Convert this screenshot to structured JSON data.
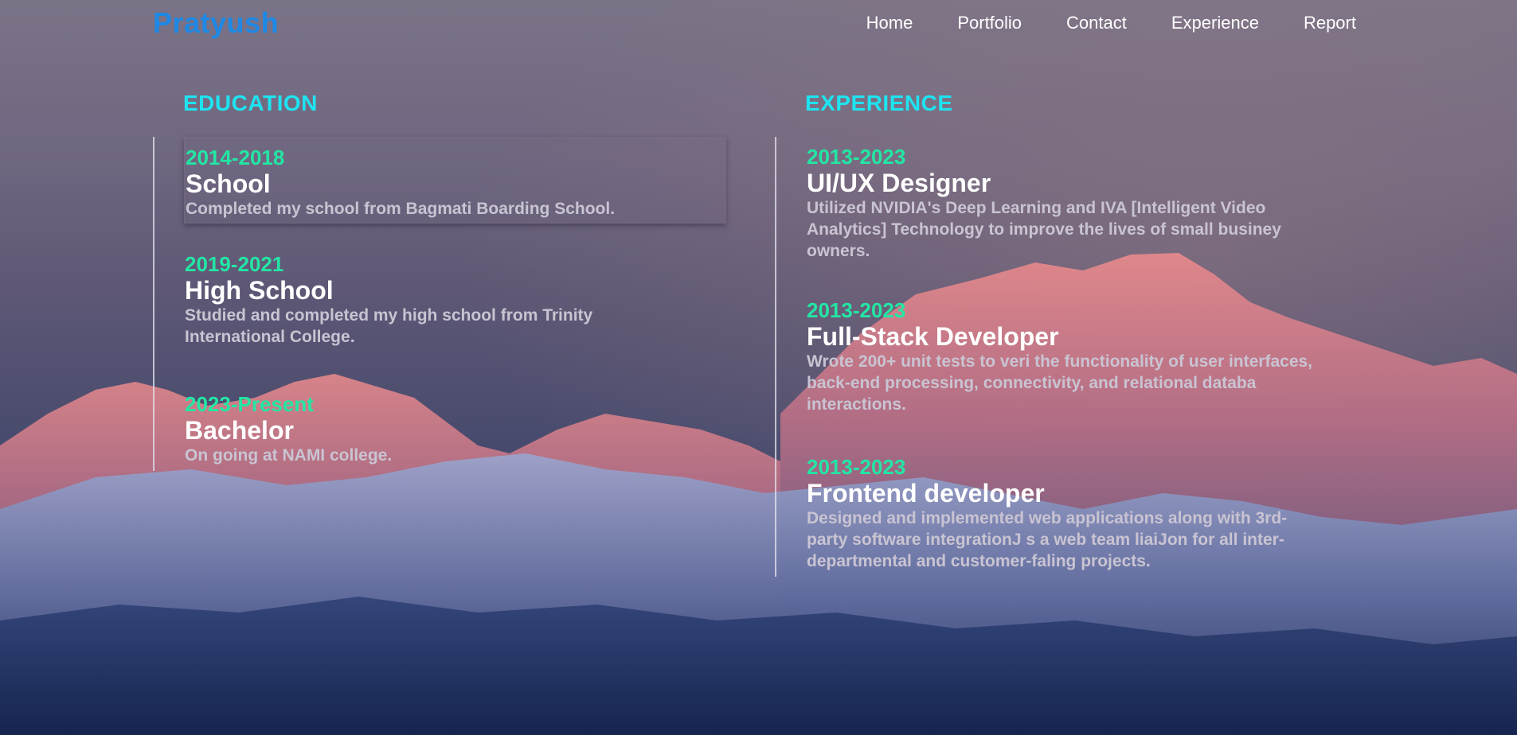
{
  "header": {
    "brand": "Pratyush",
    "nav": [
      "Home",
      "Portfolio",
      "Contact",
      "Experience",
      "Report"
    ]
  },
  "education": {
    "title": "EDUCATION",
    "items": [
      {
        "years": "2014-2018",
        "role": "School",
        "desc": "Completed my school from Bagmati Boarding School."
      },
      {
        "years": "2019-2021",
        "role": "High School",
        "desc": "Studied and completed my high school from Trinity International College."
      },
      {
        "years": "2023-Present",
        "role": "Bachelor",
        "desc": "On going at NAMI college."
      }
    ]
  },
  "experience": {
    "title": "EXPERIENCE",
    "items": [
      {
        "years": "2013-2023",
        "role": "UI/UX Designer",
        "desc": "Utilized NVIDIA's Deep Learning and IVA [Intelligent Video Analytics] Technology to improve the lives of small businey owners."
      },
      {
        "years": "2013-2023",
        "role": "Full-Stack Developer",
        "desc": "Wrote 200+ unit tests to veri the functionality of user interfaces, back-end processing, connectivity, and relational databa interactions."
      },
      {
        "years": "2013-2023",
        "role": "Frontend developer",
        "desc": "Designed and implemented web applications along with 3rd-party software integrationJ s a web team liaiJon for all inter-departmental and customer-faling projects."
      }
    ]
  },
  "theme": {
    "brand_color": "#1e88e5",
    "section_title_color": "#1ee3f0",
    "years_color": "#23e6a4",
    "role_color": "#ffffff",
    "desc_color": "#c9c4d2"
  }
}
